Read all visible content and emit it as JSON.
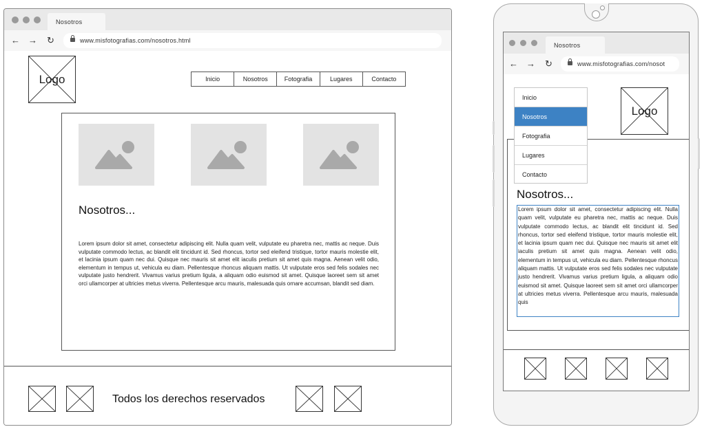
{
  "desktop": {
    "tab_title": "Nosotros",
    "url": "www.misfotografias.com/nosotros.html",
    "logo_label": "Logo",
    "nav_items": [
      "Inicio",
      "Nosotros",
      "Fotografia",
      "Lugares",
      "Contacto"
    ],
    "heading": "Nosotros...",
    "body_text": "Lorem ipsum dolor sit amet, consectetur adipiscing elit. Nulla quam velit, vulputate eu pharetra nec, mattis ac neque. Duis vulputate commodo lectus, ac blandit elit tincidunt id. Sed rhoncus, tortor sed eleifend tristique, tortor mauris molestie elit, et lacinia ipsum quam nec dui. Quisque nec mauris sit amet elit iaculis pretium sit amet quis magna. Aenean velit odio, elementum in tempus ut, vehicula eu diam. Pellentesque rhoncus aliquam mattis. Ut vulputate eros sed felis sodales nec vulputate justo hendrerit. Vivamus varius pretium ligula, a aliquam odio euismod sit amet. Quisque laoreet sem sit amet orci ullamcorper at ultricies metus viverra. Pellentesque arcu mauris, malesuada quis ornare accumsan, blandit sed diam.",
    "footer_text": "Todos los derechos reservados"
  },
  "mobile": {
    "tab_title": "Nosotros",
    "url": "www.misfotografias.com/nosot",
    "logo_label": "Logo",
    "menu_items": [
      "Inicio",
      "Nosotros",
      "Fotografia",
      "Lugares",
      "Contacto"
    ],
    "active_menu_item": "Nosotros",
    "heading": "Nosotros...",
    "body_text": "Lorem ipsum dolor sit amet, consectetur adipiscing elit. Nulla quam velit, vulputate eu pharetra nec, mattis ac neque. Duis vulputate commodo lectus, ac blandit elit tincidunt id. Sed rhoncus, tortor sed eleifend tristique, tortor mauris molestie elit, et lacinia ipsum quam nec dui. Quisque nec mauris sit amet elit iaculis pretium sit amet quis magna. Aenean velit odio, elementum in tempus ut, vehicula eu diam. Pellentesque rhoncus aliquam mattis. Ut vulputate eros sed felis sodales nec vulputate justo hendrerit. Vivamus varius pretium ligula, a aliquam odio euismod sit amet. Quisque laoreet sem sit amet orci ullamcorper at ultricies metus viverra. Pellentesque arcu mauris, malesuada quis"
  },
  "colors": {
    "highlight": "#3d82c4",
    "placeholder_fill": "#e3e3e3",
    "placeholder_icon": "#a9a9a9",
    "chrome": "#e9e9e9"
  },
  "icons": [
    "back-arrow-icon",
    "forward-arrow-icon",
    "reload-icon",
    "lock-icon",
    "image-placeholder-icon"
  ]
}
